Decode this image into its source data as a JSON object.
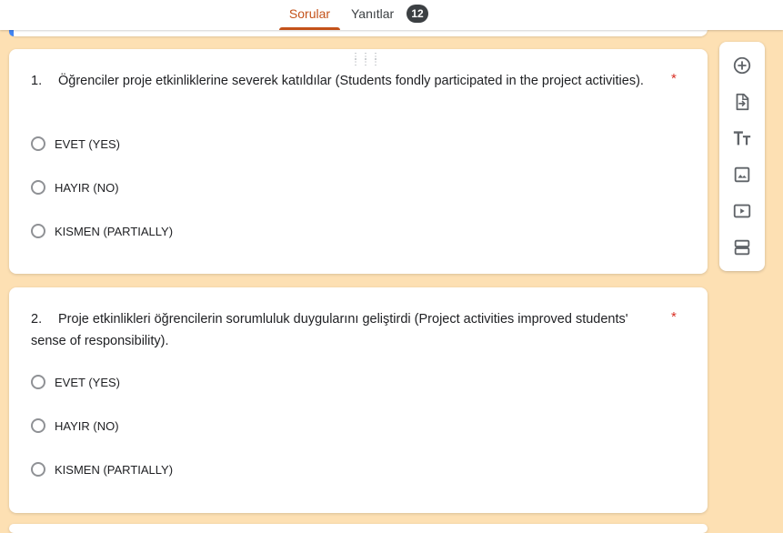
{
  "tabs": {
    "questions_label": "Sorular",
    "responses_label": "Yanıtlar",
    "responses_count": "12"
  },
  "questions": [
    {
      "number": "1.",
      "text": "Öğrenciler proje etkinliklerine severek katıldılar (Students fondly participated in the project activities).",
      "required_mark": "*",
      "options": [
        "EVET (YES)",
        "HAYIR (NO)",
        "KISMEN (PARTIALLY)"
      ]
    },
    {
      "number": "2.",
      "text": "Proje etkinlikleri öğrencilerin sorumluluk duygularını geliştirdi (Project activities improved students' sense of responsibility).",
      "required_mark": "*",
      "options": [
        "EVET (YES)",
        "HAYIR (NO)",
        "KISMEN (PARTIALLY)"
      ]
    }
  ],
  "toolbar": {
    "items": [
      "add-question-icon",
      "import-questions-icon",
      "add-title-icon",
      "add-image-icon",
      "add-video-icon",
      "add-section-icon"
    ]
  },
  "colors": {
    "background": "#fde0b3",
    "accent": "#c4521a",
    "required": "#d93025"
  }
}
